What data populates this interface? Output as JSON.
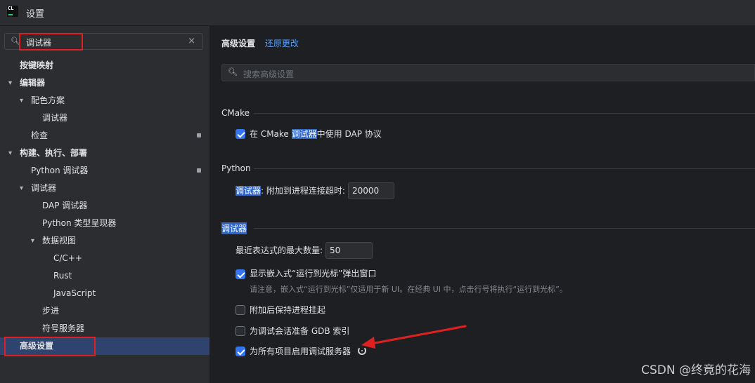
{
  "window": {
    "title": "设置",
    "logo_text": "CL"
  },
  "sidebar": {
    "search": {
      "value": "调试器",
      "clear": "×"
    },
    "tree": [
      {
        "label": "按键映射",
        "bold": true,
        "expanded": null,
        "depth": 0
      },
      {
        "label": "编辑器",
        "bold": true,
        "expanded": true,
        "depth": 0
      },
      {
        "label": "配色方案",
        "bold": false,
        "expanded": true,
        "depth": 1
      },
      {
        "label": "调试器",
        "bold": false,
        "expanded": null,
        "depth": 2
      },
      {
        "label": "检查",
        "bold": false,
        "expanded": null,
        "depth": 1,
        "locked": true
      },
      {
        "label": "构建、执行、部署",
        "bold": true,
        "expanded": true,
        "depth": 0
      },
      {
        "label": "Python 调试器",
        "bold": false,
        "expanded": null,
        "depth": 1,
        "locked": true
      },
      {
        "label": "调试器",
        "bold": false,
        "expanded": true,
        "depth": 1
      },
      {
        "label": "DAP 调试器",
        "bold": false,
        "expanded": null,
        "depth": 2
      },
      {
        "label": "Python 类型呈现器",
        "bold": false,
        "expanded": null,
        "depth": 2
      },
      {
        "label": "数据视图",
        "bold": false,
        "expanded": true,
        "depth": 2
      },
      {
        "label": "C/C++",
        "bold": false,
        "expanded": null,
        "depth": 3
      },
      {
        "label": "Rust",
        "bold": false,
        "expanded": null,
        "depth": 3
      },
      {
        "label": "JavaScript",
        "bold": false,
        "expanded": null,
        "depth": 3
      },
      {
        "label": "步进",
        "bold": false,
        "expanded": null,
        "depth": 2
      },
      {
        "label": "符号服务器",
        "bold": false,
        "expanded": null,
        "depth": 2
      },
      {
        "label": "高级设置",
        "bold": true,
        "expanded": null,
        "depth": 0,
        "selected": true
      }
    ]
  },
  "content": {
    "title": "高级设置",
    "revert_label": "还原更改",
    "search_placeholder": "搜索高级设置",
    "cmake": {
      "title": "CMake",
      "dap_before": "在 CMake ",
      "dap_match": "调试器",
      "dap_after": "中使用 DAP 协议",
      "dap_checked": true
    },
    "python": {
      "title": "Python",
      "timeout_match": "调试器",
      "timeout_after": ": 附加到进程连接超时:",
      "timeout_value": "20000"
    },
    "debugger": {
      "title": "调试器",
      "max_expr_label": "最近表达式的最大数量:",
      "max_expr_value": "50",
      "inline_run_label": "显示嵌入式“运行到光标”弹出窗口",
      "inline_run_checked": true,
      "inline_run_hint": "请注意，嵌入式“运行到光标”仅适用于新 UI。在经典 UI 中，点击行号将执行“运行到光标”。",
      "keep_suspended_label": "附加后保持进程挂起",
      "keep_suspended_checked": false,
      "gdb_index_label": "为调试会话准备 GDB 索引",
      "gdb_index_checked": false,
      "debug_server_label": "为所有项目启用调试服务器",
      "debug_server_checked": true
    }
  },
  "watermark": "CSDN @终竟的花海",
  "colors": {
    "accent": "#3574f0",
    "link": "#589df6",
    "annotation": "#e02020",
    "selection": "#2e436e"
  }
}
